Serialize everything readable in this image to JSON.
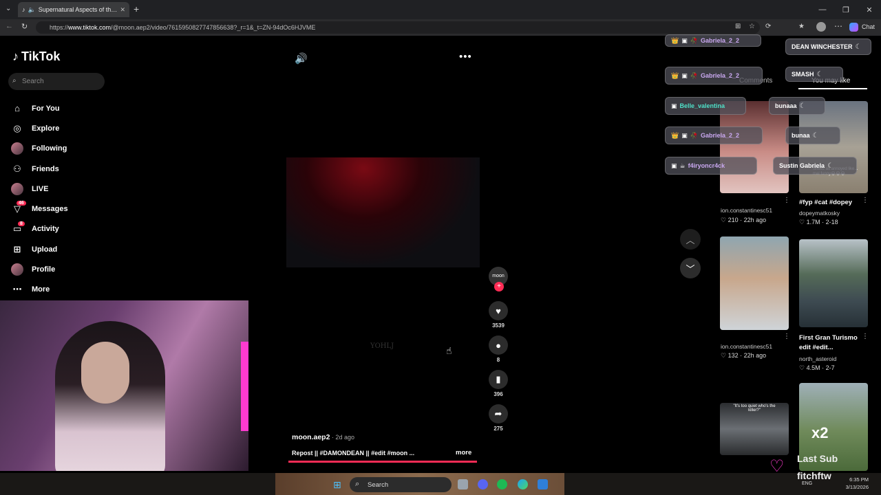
{
  "browser": {
    "tab_title": "Supernatural Aspects of the M",
    "url_prefix": "https://",
    "url_domain": "www.tiktok.com",
    "url_path": "/@moon.aep2/video/7615950827747856638?_r=1&_t=ZN-94dOc6HJVME",
    "chat_label": "Chat"
  },
  "sidebar": {
    "logo": "TikTok",
    "search_placeholder": "Search",
    "items": [
      {
        "label": "For You",
        "icon": "home-icon"
      },
      {
        "label": "Explore",
        "icon": "compass-icon"
      },
      {
        "label": "Following",
        "icon": "avatar"
      },
      {
        "label": "Friends",
        "icon": "friends-icon"
      },
      {
        "label": "LIVE",
        "icon": "avatar"
      },
      {
        "label": "Messages",
        "icon": "messages-icon",
        "badge": "46"
      },
      {
        "label": "Activity",
        "icon": "activity-icon",
        "badge": "8"
      },
      {
        "label": "Upload",
        "icon": "upload-icon"
      },
      {
        "label": "Profile",
        "icon": "avatar"
      },
      {
        "label": "More",
        "icon": "more-icon"
      }
    ]
  },
  "video": {
    "watermark": "YOHLJ",
    "author": "moon.aep2",
    "ago": " · 2d ago",
    "caption": "Repost || #DAMONDEAN || #edit #moon ...",
    "more_label": "more",
    "progress": 0.99,
    "avatar_text": "moon",
    "likes": "3539",
    "comments": "8",
    "saves": "396",
    "shares": "275"
  },
  "chat_overlay": [
    {
      "name": "Gabriela_2_2",
      "style": "purple"
    },
    {
      "name": "Gabriela_2_2",
      "style": "purple"
    },
    {
      "name": "Belle_valentina",
      "style": "teal"
    },
    {
      "name": "Gabriela_2_2",
      "style": "purple"
    },
    {
      "name": "f4iryoncr4ck",
      "style": "purple"
    }
  ],
  "chat_overlay_right": [
    {
      "name": "DEAN WINCHESTER"
    },
    {
      "name": "SMASH"
    },
    {
      "name": "bunaaa"
    },
    {
      "name": "bunaa"
    },
    {
      "name": "Sustin Gabriela"
    }
  ],
  "right_panel": {
    "tab_comments": "Comments",
    "tab_you_may_like": "You may like",
    "cards": [
      {
        "title": "",
        "user": "ion.constantinesc51",
        "likes": "210",
        "age": "22h ago"
      },
      {
        "title": "#fyp #cat #dopey",
        "user": "dopeymatkosky",
        "likes": "1.7M",
        "age": "2-18"
      },
      {
        "title": "",
        "user": "ion.constantinesc51",
        "likes": "132",
        "age": "22h ago"
      },
      {
        "title": "First Gran Turismo edit #edit...",
        "user": "north_asteroid",
        "likes": "4.5M",
        "age": "2-7"
      },
      {
        "title": "",
        "user": "",
        "likes": "",
        "age": ""
      },
      {
        "title": "",
        "user": "",
        "likes": "",
        "age": ""
      }
    ],
    "thumb_text_cat": "Sheez as annoyed like... mai funny😂😂😂",
    "thumb_text_quiet": "\"It's too quiet who's the killer?\"",
    "thumb_text_x2": "x2"
  },
  "stream_overlay": {
    "last_sub_label": "Last Sub",
    "last_sub_name": "fitchftw"
  },
  "taskbar": {
    "search_label": "Search",
    "lang": "ENG",
    "time": "6:35 PM",
    "date": "3/13/2026"
  },
  "colors": {
    "accent": "#fe2c55",
    "background": "#000000",
    "chrome": "#202124"
  }
}
